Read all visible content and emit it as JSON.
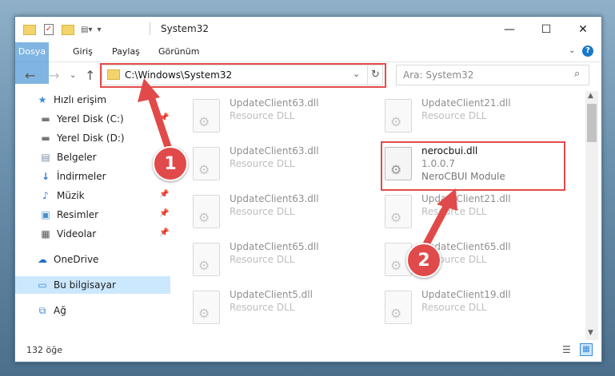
{
  "window": {
    "title": "System32"
  },
  "window_controls": {
    "minimize": "—",
    "maximize": "☐",
    "close": "✕"
  },
  "ribbon": {
    "tabs": [
      "Dosya",
      "Giriş",
      "Paylaş",
      "Görünüm"
    ],
    "help": "?"
  },
  "address": {
    "path": "C:\\Windows\\System32"
  },
  "search": {
    "placeholder": "Ara: System32"
  },
  "sidebar": {
    "items": [
      {
        "label": "Hızlı erişim",
        "icon": "star-icon"
      },
      {
        "label": "Yerel Disk (C:)",
        "icon": "drive-icon"
      },
      {
        "label": "Yerel Disk (D:)",
        "icon": "drive-icon"
      },
      {
        "label": "Belgeler",
        "icon": "documents-icon"
      },
      {
        "label": "İndirmeler",
        "icon": "download-icon"
      },
      {
        "label": "Müzik",
        "icon": "music-icon"
      },
      {
        "label": "Resimler",
        "icon": "pictures-icon"
      },
      {
        "label": "Videolar",
        "icon": "videos-icon"
      },
      {
        "label": "OneDrive",
        "icon": "cloud-icon"
      },
      {
        "label": "Bu bilgisayar",
        "icon": "computer-icon"
      },
      {
        "label": "Ağ",
        "icon": "network-icon"
      }
    ]
  },
  "files": [
    {
      "name": "UpdateClient63.dll",
      "desc": "Resource DLL"
    },
    {
      "name": "UpdateClient21.dll",
      "desc": "Resource DLL"
    },
    {
      "name": "UpdateClient63.dll",
      "desc": "Resource DLL"
    },
    {
      "name": "nerocbui.dll",
      "version": "1.0.0.7",
      "desc": "NeroCBUI Module"
    },
    {
      "name": "UpdateClient63.dll",
      "desc": "Resource DLL"
    },
    {
      "name": "UpdateClient21.dll",
      "desc": "Resource DLL"
    },
    {
      "name": "UpdateClient65.dll",
      "desc": "Resource DLL"
    },
    {
      "name": "UpdateClient65.dll",
      "desc": "Resource DLL"
    },
    {
      "name": "UpdateClient5.dll",
      "desc": "Resource DLL"
    },
    {
      "name": "UpdateClient19.dll",
      "desc": "Resource DLL"
    }
  ],
  "status": {
    "count": "132 öğe"
  },
  "annotations": {
    "badge1": "1",
    "badge2": "2"
  },
  "colors": {
    "accent": "#1979ca",
    "highlight": "#e54b4b",
    "arrow": "#e14a4a"
  }
}
